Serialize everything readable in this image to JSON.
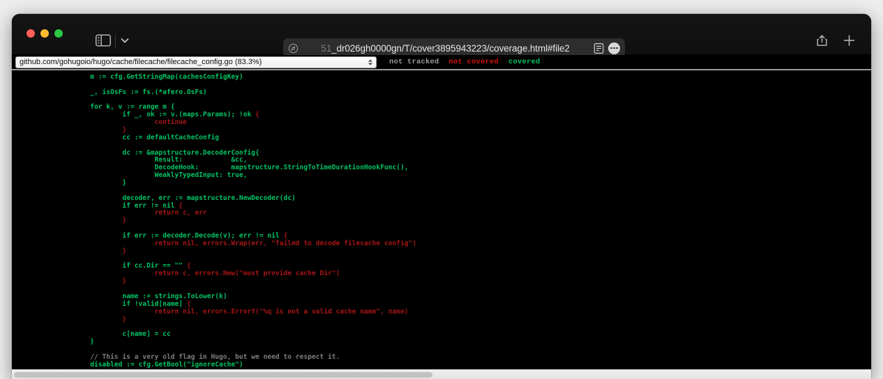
{
  "window": {
    "traffic_lights": [
      {
        "name": "close",
        "color": "#ff5f57"
      },
      {
        "name": "minimize",
        "color": "#febc2e"
      },
      {
        "name": "zoom",
        "color": "#28c840"
      }
    ]
  },
  "toolbar": {
    "sidebar_toggle": "sidebar-icon",
    "chevron": "chevron-down-icon",
    "compass": "compass-icon",
    "url_dim_prefix": "51",
    "url_text": "_dr026gh0000gn/T/cover3895943223/coverage.html#file2",
    "reader_icon": "reader-view-icon",
    "more_icon": "ellipsis-icon",
    "share_icon": "share-icon",
    "new_tab_icon": "plus-icon"
  },
  "coverage": {
    "file_selector_value": "github.com/gohugoio/hugo/cache/filecache/filecache_config.go (83.3%)",
    "legend": {
      "not_tracked": "not tracked",
      "not_covered": "not covered",
      "covered": "covered"
    },
    "colors": {
      "covered": "#00c464",
      "not_covered": "#a51515",
      "not_tracked": "#7d7d7d",
      "background": "#000000"
    }
  },
  "code": {
    "lines": [
      [
        {
          "t": "cov",
          "s": "\tm := cfg.GetStringMap(cachesConfigKey)"
        }
      ],
      [
        {
          "t": "cov",
          "s": ""
        }
      ],
      [
        {
          "t": "cov",
          "s": "\t_, isOsFs := fs.(*afero.OsFs)"
        }
      ],
      [
        {
          "t": "cov",
          "s": ""
        }
      ],
      [
        {
          "t": "cov",
          "s": "\tfor k, v := range m {"
        }
      ],
      [
        {
          "t": "cov",
          "s": "\t\tif _, ok := v.(maps.Params); !ok "
        },
        {
          "t": "unc",
          "s": "{"
        }
      ],
      [
        {
          "t": "unc",
          "s": "\t\t\tcontinue"
        }
      ],
      [
        {
          "t": "unc",
          "s": "\t\t}"
        }
      ],
      [
        {
          "t": "cov",
          "s": "\t\tcc := defaultCacheConfig"
        }
      ],
      [
        {
          "t": "cov",
          "s": ""
        }
      ],
      [
        {
          "t": "cov",
          "s": "\t\tdc := &mapstructure.DecoderConfig{"
        }
      ],
      [
        {
          "t": "cov",
          "s": "\t\t\tResult:            &cc,"
        }
      ],
      [
        {
          "t": "cov",
          "s": "\t\t\tDecodeHook:        mapstructure.StringToTimeDurationHookFunc(),"
        }
      ],
      [
        {
          "t": "cov",
          "s": "\t\t\tWeaklyTypedInput: true,"
        }
      ],
      [
        {
          "t": "cov",
          "s": "\t\t}"
        }
      ],
      [
        {
          "t": "cov",
          "s": ""
        }
      ],
      [
        {
          "t": "cov",
          "s": "\t\tdecoder, err := mapstructure.NewDecoder(dc)"
        }
      ],
      [
        {
          "t": "cov",
          "s": "\t\tif err != nil "
        },
        {
          "t": "unc",
          "s": "{"
        }
      ],
      [
        {
          "t": "unc",
          "s": "\t\t\treturn c, err"
        }
      ],
      [
        {
          "t": "unc",
          "s": "\t\t}"
        }
      ],
      [
        {
          "t": "cov",
          "s": ""
        }
      ],
      [
        {
          "t": "cov",
          "s": "\t\tif err := decoder.Decode(v); err != nil "
        },
        {
          "t": "unc",
          "s": "{"
        }
      ],
      [
        {
          "t": "unc",
          "s": "\t\t\treturn nil, errors.Wrap(err, \"failed to decode filecache config\")"
        }
      ],
      [
        {
          "t": "unc",
          "s": "\t\t}"
        }
      ],
      [
        {
          "t": "cov",
          "s": ""
        }
      ],
      [
        {
          "t": "cov",
          "s": "\t\tif cc.Dir == \"\" "
        },
        {
          "t": "unc",
          "s": "{"
        }
      ],
      [
        {
          "t": "unc",
          "s": "\t\t\treturn c, errors.New(\"must provide cache Dir\")"
        }
      ],
      [
        {
          "t": "unc",
          "s": "\t\t}"
        }
      ],
      [
        {
          "t": "cov",
          "s": ""
        }
      ],
      [
        {
          "t": "cov",
          "s": "\t\tname := strings.ToLower(k)"
        }
      ],
      [
        {
          "t": "cov",
          "s": "\t\tif !valid[name] "
        },
        {
          "t": "unc",
          "s": "{"
        }
      ],
      [
        {
          "t": "unc",
          "s": "\t\t\treturn nil, errors.Errorf(\"%q is not a valid cache name\", name)"
        }
      ],
      [
        {
          "t": "unc",
          "s": "\t\t}"
        }
      ],
      [
        {
          "t": "cov",
          "s": ""
        }
      ],
      [
        {
          "t": "cov",
          "s": "\t\tc[name] = cc"
        }
      ],
      [
        {
          "t": "cov",
          "s": "\t}"
        }
      ],
      [
        {
          "t": "cov",
          "s": ""
        }
      ],
      [
        {
          "t": "nt",
          "s": "\t// This is a very old flag in Hugo, but we need to respect it."
        }
      ],
      [
        {
          "t": "cov",
          "s": "\tdisabled := cfg.GetBool(\"ignoreCache\")"
        }
      ]
    ]
  }
}
